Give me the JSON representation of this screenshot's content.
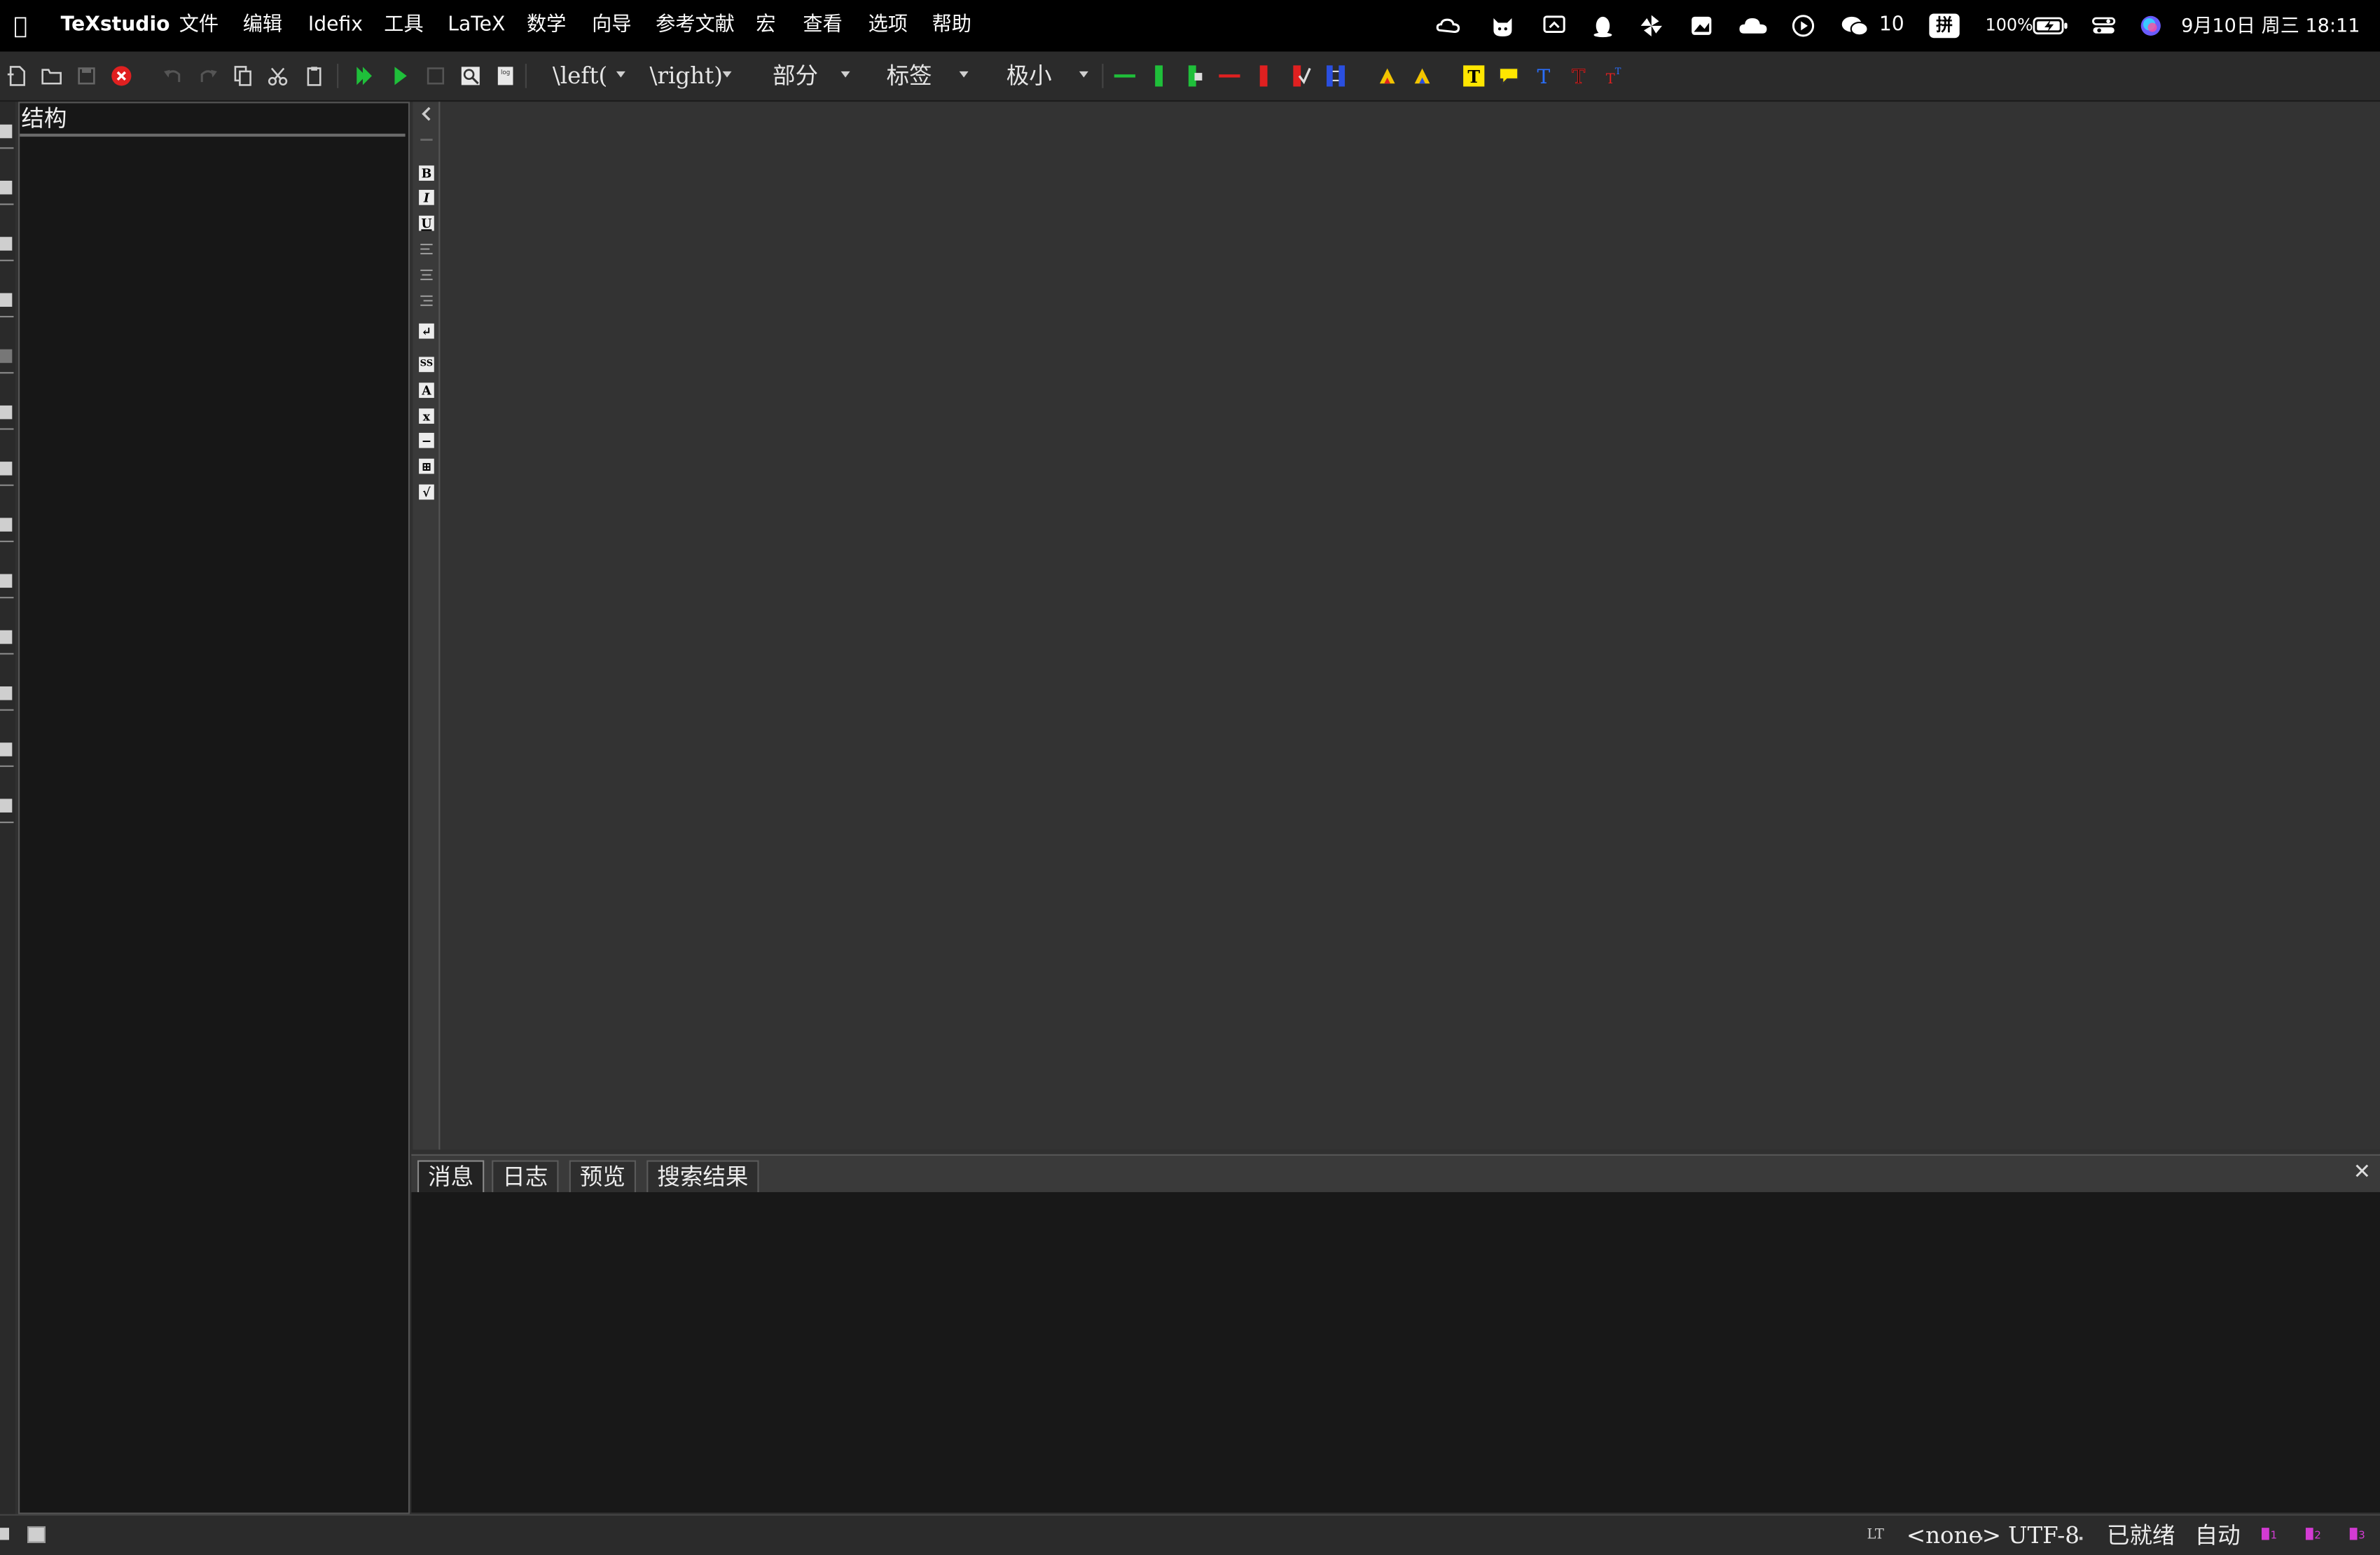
{
  "menubar": {
    "app_name": "TeXstudio",
    "menus": [
      "文件",
      "编辑",
      "Idefix",
      "工具",
      "LaTeX",
      "数学",
      "向导",
      "参考文献",
      "宏",
      "查看",
      "选项",
      "帮助"
    ],
    "status": {
      "wechat_count": "10",
      "input_method": "拼",
      "battery": "100%",
      "datetime": "9月10日 周三  18:11"
    }
  },
  "toolbar": {
    "left_delim": "\\left(",
    "right_delim": "\\right)",
    "section_combo": "部分",
    "label_combo": "标签",
    "size_combo": "极小"
  },
  "structure": {
    "title": "结构"
  },
  "messages": {
    "tabs": [
      "消息",
      "日志",
      "预览",
      "搜索结果"
    ],
    "close_glyph": "✕"
  },
  "statusbar": {
    "lt_label": "LT",
    "language": "<none>",
    "encoding": "UTF-8",
    "ready": "已就绪",
    "mode": "自动"
  },
  "colors": {
    "menubar_bg": "#000000",
    "editor_bg": "#333333",
    "panel_bg": "#171717"
  }
}
